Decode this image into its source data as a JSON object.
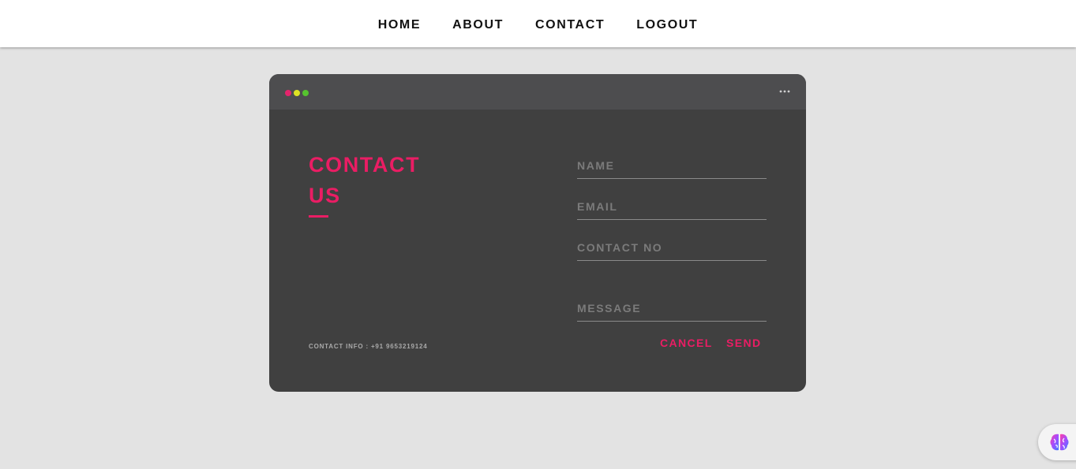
{
  "nav": {
    "items": [
      {
        "label": "HOME"
      },
      {
        "label": "ABOUT"
      },
      {
        "label": "CONTACT"
      },
      {
        "label": "LOGOUT"
      }
    ]
  },
  "card": {
    "window_dots": [
      "#e3246c",
      "#dde324",
      "#56c42f"
    ],
    "more_icon": "ellipsis-icon",
    "title_line1": "CONTACT",
    "title_line2": "US",
    "contact_info": "CONTACT INFO : +91 9653219124",
    "form": {
      "name_placeholder": "NAME",
      "email_placeholder": "EMAIL",
      "contact_placeholder": "CONTACT NO",
      "message_placeholder": "MESSAGE",
      "cancel_label": "CANCEL",
      "send_label": "SEND"
    }
  },
  "widget": {
    "icon": "brain-icon"
  },
  "colors": {
    "accent": "#ea1d64",
    "background": "#e3e3e3",
    "card": "#404040",
    "card_topbar": "#4d4d4f"
  }
}
